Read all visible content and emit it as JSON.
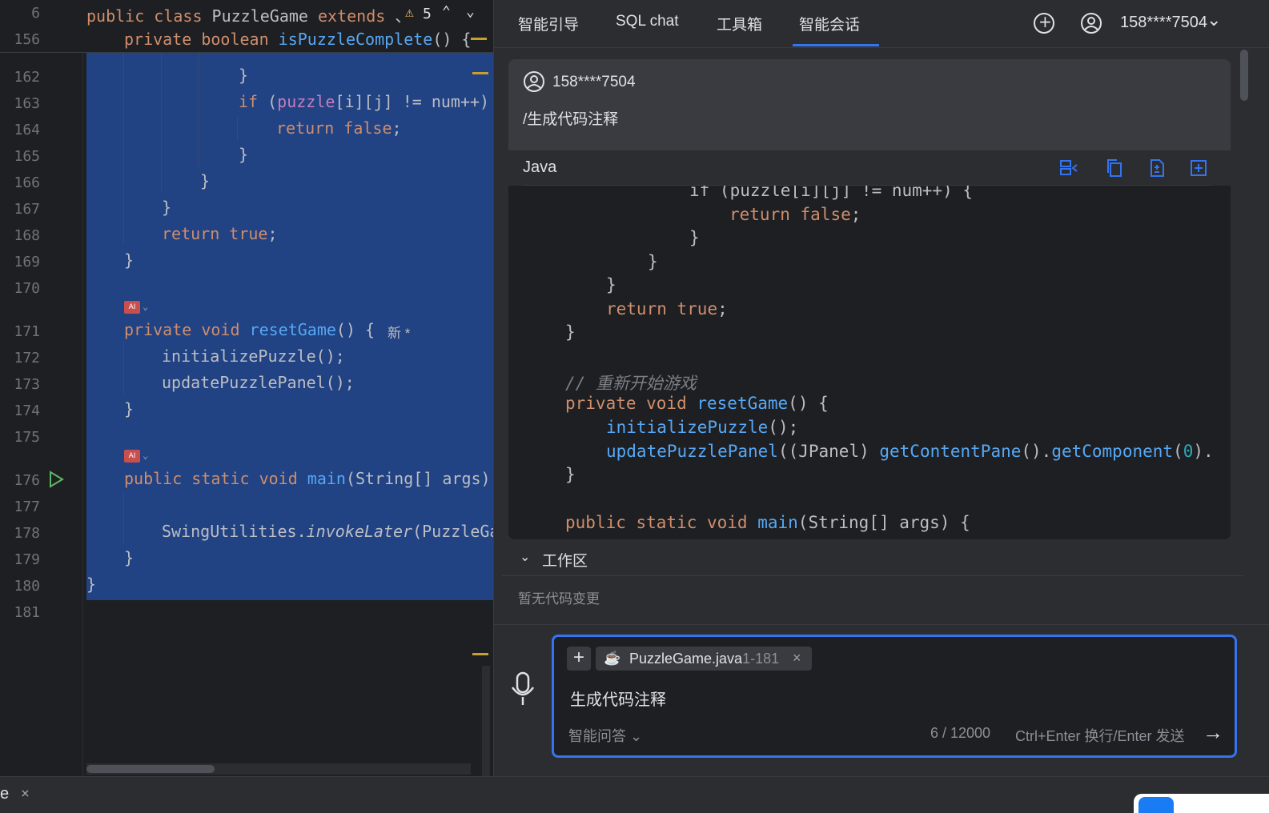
{
  "editor": {
    "sticky1": {
      "line": "6",
      "prefix": "public class ",
      "name": "PuzzleGame ",
      "extends": "extends ",
      "more": "、",
      "warn_count": "5"
    },
    "sticky2": {
      "line": "156",
      "kw1": "private ",
      "kw2": "boolean ",
      "fn": "isPuzzleComplete",
      "rest": "() {"
    },
    "line_numbers": [
      "162",
      "163",
      "164",
      "165",
      "166",
      "167",
      "168",
      "169",
      "170",
      "171",
      "172",
      "173",
      "174",
      "175",
      "176",
      "177",
      "178",
      "179",
      "180",
      "181"
    ],
    "lines": {
      "l162": "}",
      "l163_kw": "if ",
      "l163_a": "(",
      "l163_fld": "puzzle",
      "l163_b": "[i][j] != ",
      "l163_c": "num++)",
      "l164_kw": "return ",
      "l164_kw2": "false",
      "l164_rest": ";",
      "l165": "}",
      "l166": "}",
      "l167": "}",
      "l168_kw": "return ",
      "l168_kw2": "true",
      "l168_rest": ";",
      "l169": "}",
      "l171_kw": "private void ",
      "l171_fn": "resetGame",
      "l171_rest": "() {",
      "l171_hint": "新 *",
      "l172": "initializePuzzle();",
      "l173": "updatePuzzlePanel();",
      "l174": "}",
      "l176_kw": "public static void ",
      "l176_fn": "main",
      "l176_rest": "(String[] args)",
      "l178_a": "SwingUtilities.",
      "l178_it": "invokeLater",
      "l178_b": "(PuzzleGa",
      "l179": "}",
      "l180": "}"
    },
    "ai_mark": "AI"
  },
  "panel": {
    "tabs": [
      "智能引导",
      "SQL chat",
      "工具箱",
      "智能会话"
    ],
    "active_tab": "智能会话",
    "account": "158****7504",
    "message": {
      "user": "158****7504",
      "text": "/生成代码注释"
    },
    "code_block": {
      "lang": "Java",
      "lines": {
        "a1": "if (puzzle[i][j] != num++) {",
        "a2_kw": "return ",
        "a2_kw2": "false",
        "a2_rest": ";",
        "a3": "}",
        "a4": "}",
        "a5": "}",
        "a6_kw": "return ",
        "a6_kw2": "true",
        "a6_rest": ";",
        "a7": "}",
        "a8": "// 重新开始游戏",
        "a9_kw": "private void ",
        "a9_fn": "resetGame",
        "a9_rest": "() {",
        "a10_fn": "initializePuzzle",
        "a10_rest": "();",
        "a11_fn": "updatePuzzlePanel",
        "a11_b": "((JPanel) ",
        "a11_fn2": "getContentPane",
        "a11_c": "().",
        "a11_fn3": "getComponent",
        "a11_d": "(",
        "a11_num": "0",
        "a11_e": ").",
        "a12": "}",
        "a13_kw": "public static void ",
        "a13_fn": "main",
        "a13_rest": "(String[] args) {"
      }
    },
    "workspace": {
      "title": "工作区",
      "empty": "暂无代码变更"
    },
    "input": {
      "file_name": "PuzzleGame.java",
      "file_range": "1-181",
      "text": "生成代码注释",
      "mode": "智能问答",
      "count": "6 / 12000",
      "hint": "Ctrl+Enter 换行/Enter 发送"
    }
  },
  "statusbar": {
    "tab_label": "e"
  },
  "colors": {
    "accent": "#3574f0",
    "selection": "#214283",
    "keyword": "#cf8e6d",
    "function": "#56a8f5"
  }
}
